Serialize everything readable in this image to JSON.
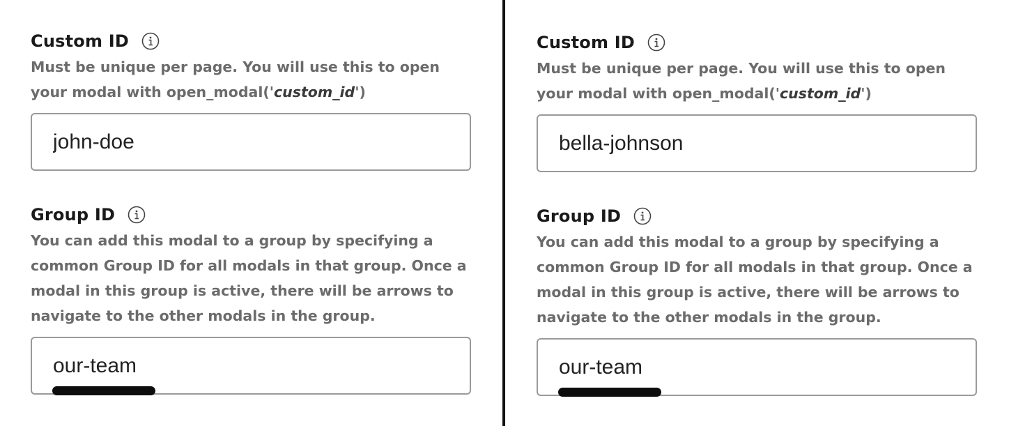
{
  "panels": [
    {
      "custom_id": {
        "title": "Custom ID",
        "desc_prefix": "Must be unique per page. You will use this to open your modal with open_modal('",
        "desc_code": "custom_id",
        "desc_suffix": "')",
        "value": "john-doe"
      },
      "group_id": {
        "title": "Group ID",
        "desc": "You can add this modal to a group by specifying a common Group ID for all modals in that group. Once a modal in this group is active, there will be arrows to navigate to the other modals in the group.",
        "value": "our-team"
      }
    },
    {
      "custom_id": {
        "title": "Custom ID",
        "desc_prefix": "Must be unique per page. You will use this to open your modal with open_modal('",
        "desc_code": "custom_id",
        "desc_suffix": "')",
        "value": "bella-johnson"
      },
      "group_id": {
        "title": "Group ID",
        "desc": "You can add this modal to a group by specifying a common Group ID for all modals in that group. Once a modal in this group is active, there will be arrows to navigate to the other modals in the group.",
        "value": "our-team"
      }
    }
  ],
  "icons": {
    "info": "info-circle-icon"
  },
  "colors": {
    "divider": "#111111",
    "input_border": "#9a9a9a",
    "description": "#6b6b6b",
    "underline_mark": "#0d0d0d"
  }
}
